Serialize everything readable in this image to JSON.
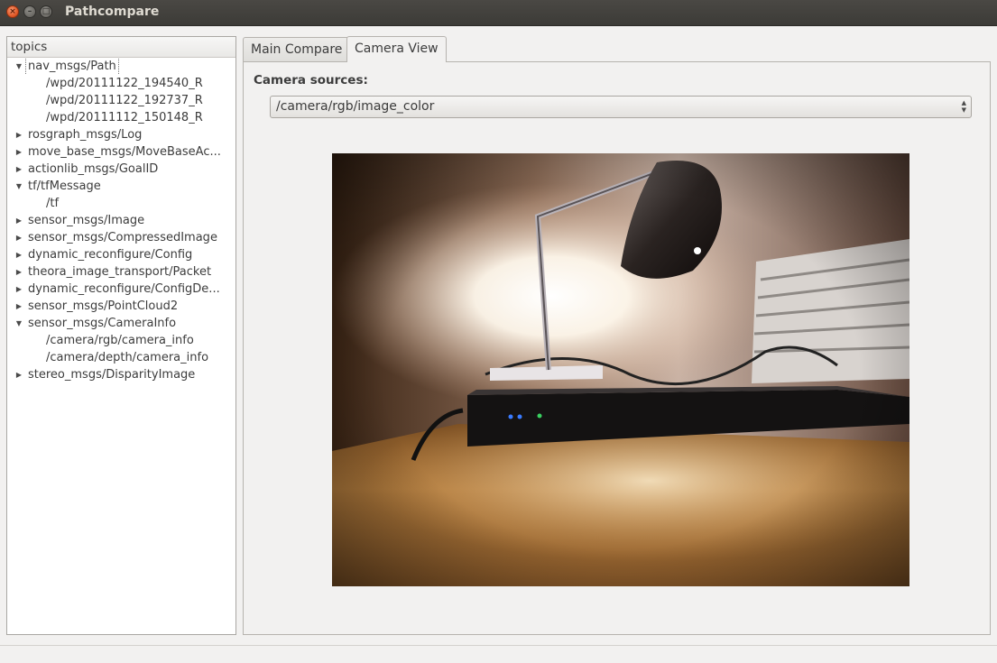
{
  "window": {
    "title": "Pathcompare",
    "controls": {
      "close": "×",
      "minimize": "–",
      "maximize": "□"
    }
  },
  "tree": {
    "header": "topics",
    "rows": [
      {
        "label": "nav_msgs/Path",
        "level": 0,
        "expanded": true,
        "selected": true
      },
      {
        "label": "/wpd/20111122_194540_R",
        "level": 1
      },
      {
        "label": "/wpd/20111122_192737_R",
        "level": 1
      },
      {
        "label": "/wpd/20111112_150148_R",
        "level": 1
      },
      {
        "label": "rosgraph_msgs/Log",
        "level": 0,
        "expanded": false
      },
      {
        "label": "move_base_msgs/MoveBaseAc...",
        "level": 0,
        "expanded": false
      },
      {
        "label": "actionlib_msgs/GoalID",
        "level": 0,
        "expanded": false
      },
      {
        "label": "tf/tfMessage",
        "level": 0,
        "expanded": true
      },
      {
        "label": "/tf",
        "level": 1
      },
      {
        "label": "sensor_msgs/Image",
        "level": 0,
        "expanded": false
      },
      {
        "label": "sensor_msgs/CompressedImage",
        "level": 0,
        "expanded": false
      },
      {
        "label": "dynamic_reconfigure/Config",
        "level": 0,
        "expanded": false
      },
      {
        "label": "theora_image_transport/Packet",
        "level": 0,
        "expanded": false
      },
      {
        "label": "dynamic_reconfigure/ConfigDe...",
        "level": 0,
        "expanded": false
      },
      {
        "label": "sensor_msgs/PointCloud2",
        "level": 0,
        "expanded": false
      },
      {
        "label": "sensor_msgs/CameraInfo",
        "level": 0,
        "expanded": true
      },
      {
        "label": "/camera/rgb/camera_info",
        "level": 1
      },
      {
        "label": "/camera/depth/camera_info",
        "level": 1
      },
      {
        "label": "stereo_msgs/DisparityImage",
        "level": 0,
        "expanded": false
      }
    ]
  },
  "tabs": [
    {
      "label": "Main Compare",
      "active": false
    },
    {
      "label": "Camera View",
      "active": true
    }
  ],
  "camera_view": {
    "sources_label": "Camera sources:",
    "selected_source": "/camera/rgb/image_color",
    "image_icon": "camera-feed-image"
  }
}
